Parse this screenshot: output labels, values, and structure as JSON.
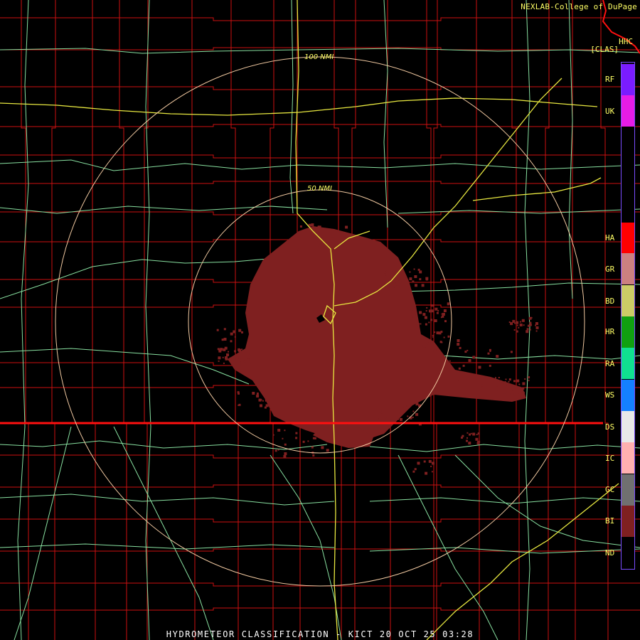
{
  "header": {
    "credit": "NEXLAB-College of DuPage",
    "site_code": "HHC",
    "product_tag": "[CLAS]"
  },
  "range_rings": {
    "inner_label": "50 NMI",
    "outer_label": "100 NMI"
  },
  "legend": {
    "items": [
      {
        "code": "RF",
        "color": "#7a1cff"
      },
      {
        "code": "UK",
        "color": "#e61ce6"
      },
      {
        "code": "HA",
        "color": "#ff0000"
      },
      {
        "code": "GR",
        "color": "#cc8080"
      },
      {
        "code": "BD",
        "color": "#cccc66"
      },
      {
        "code": "HR",
        "color": "#10a010"
      },
      {
        "code": "RA",
        "color": "#10e090"
      },
      {
        "code": "WS",
        "color": "#1480ff"
      },
      {
        "code": "DS",
        "color": "#e8e8e8"
      },
      {
        "code": "IC",
        "color": "#ffb0b0"
      },
      {
        "code": "GC",
        "color": "#707070"
      },
      {
        "code": "BI",
        "color": "#7f2020"
      },
      {
        "code": "ND",
        "color": "#000000"
      }
    ]
  },
  "colors": {
    "county_lines": "#cc1111",
    "roads": "#88e0a0",
    "highways": "#e8e840",
    "state_line": "#ff1010",
    "rings": "#f0c8a0",
    "echo": "#7f2020"
  },
  "footer": {
    "text": "HYDROMETEOR CLASSIFICATION - KICT 20 OCT 25 03:28"
  }
}
